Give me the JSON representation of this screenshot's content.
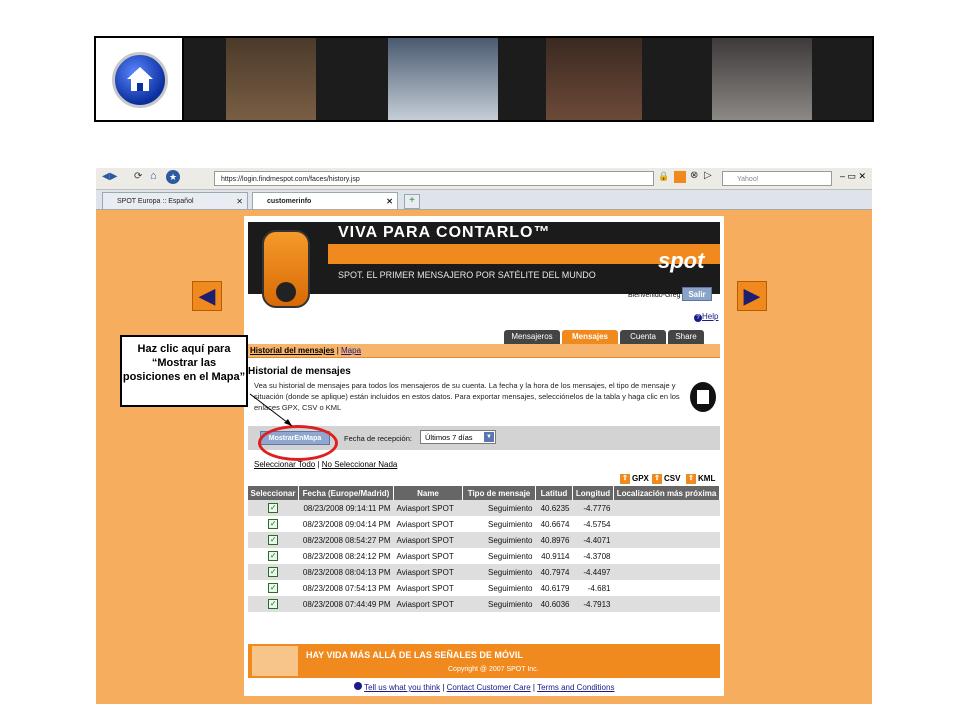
{
  "browser": {
    "url": "https://login.findmespot.com/faces/history.jsp",
    "search_placeholder": "Yahoo!",
    "tabs": [
      {
        "label": "SPOT Europa :: Español"
      },
      {
        "label": "customerinfo"
      }
    ]
  },
  "header": {
    "slogan": "VIVA PARA CONTARLO™",
    "tagline": "SPOT. EL PRIMER MENSAJERO POR SATÉLITE DEL MUNDO",
    "logo": "spot",
    "welcome": "Bienvenido-Greg",
    "logout_label": "Salir",
    "help_label": "Help"
  },
  "nav": {
    "tabs": [
      {
        "label": "Mensajeros"
      },
      {
        "label": "Mensajes"
      },
      {
        "label": "Cuenta"
      },
      {
        "label": "Share"
      }
    ]
  },
  "breadcrumb": {
    "current": "Historial del mensajes",
    "sep": " | ",
    "link": "Mapa"
  },
  "section": {
    "title": "Historial de mensajes",
    "description": "Vea su historial de mensajes para todos los mensajeros de su cuenta. La fecha y la hora de los mensajes, el tipo de mensaje y situación (donde se aplique) están incluidos en estos datos. Para exportar mensajes, selecciónelos de la tabla y haga clic en los enlaces GPX, CSV o KML"
  },
  "filter": {
    "button_label": "MostrarEnMapa",
    "date_label": "Fecha de recepción:",
    "date_value": "Últimos 7 días"
  },
  "selection": {
    "select_all": "Seleccionar Todo",
    "sep": " | ",
    "select_none": "No Seleccionar Nada"
  },
  "export": {
    "gpx": "GPX",
    "csv": "CSV",
    "kml": "KML"
  },
  "table": {
    "headers": [
      "Seleccionar",
      "Fecha (Europe/Madrid)",
      "Name",
      "Tipo de mensaje",
      "Latitud",
      "Longitud",
      "Localización más próxima"
    ],
    "rows": [
      {
        "date": "08/23/2008 09:14:11 PM",
        "name": "Aviasport SPOT",
        "type": "Seguimiento",
        "lat": "40.6235",
        "lon": "-4.7776"
      },
      {
        "date": "08/23/2008 09:04:14 PM",
        "name": "Aviasport SPOT",
        "type": "Seguimiento",
        "lat": "40.6674",
        "lon": "-4.5754"
      },
      {
        "date": "08/23/2008 08:54:27 PM",
        "name": "Aviasport SPOT",
        "type": "Seguimiento",
        "lat": "40.8976",
        "lon": "-4.4071"
      },
      {
        "date": "08/23/2008 08:24:12 PM",
        "name": "Aviasport SPOT",
        "type": "Seguimiento",
        "lat": "40.9114",
        "lon": "-4.3708"
      },
      {
        "date": "08/23/2008 08:04:13 PM",
        "name": "Aviasport SPOT",
        "type": "Seguimiento",
        "lat": "40.7974",
        "lon": "-4.4497"
      },
      {
        "date": "08/23/2008 07:54:13 PM",
        "name": "Aviasport SPOT",
        "type": "Seguimiento",
        "lat": "40.6179",
        "lon": "-4.681"
      },
      {
        "date": "08/23/2008 07:44:49 PM",
        "name": "Aviasport SPOT",
        "type": "Seguimiento",
        "lat": "40.6036",
        "lon": "-4.7913"
      }
    ]
  },
  "footer": {
    "slogan": "HAY VIDA MÁS ALLÁ DE LAS SEÑALES DE MÓVIL",
    "copyright": "Copyright @ 2007 SPOT Inc.",
    "links": [
      "Tell us what you think",
      "Contact Customer Care",
      "Terms and Conditions"
    ],
    "sep": " | "
  },
  "slide": {
    "callout": "Haz clic aquí para “Mostrar las posiciones en el Mapa”",
    "prev": "◀",
    "next": "▶"
  },
  "colors": {
    "accent": "#f08a1e",
    "browser_bg": "#f6ad5e",
    "highlight": "#e01e1e"
  }
}
